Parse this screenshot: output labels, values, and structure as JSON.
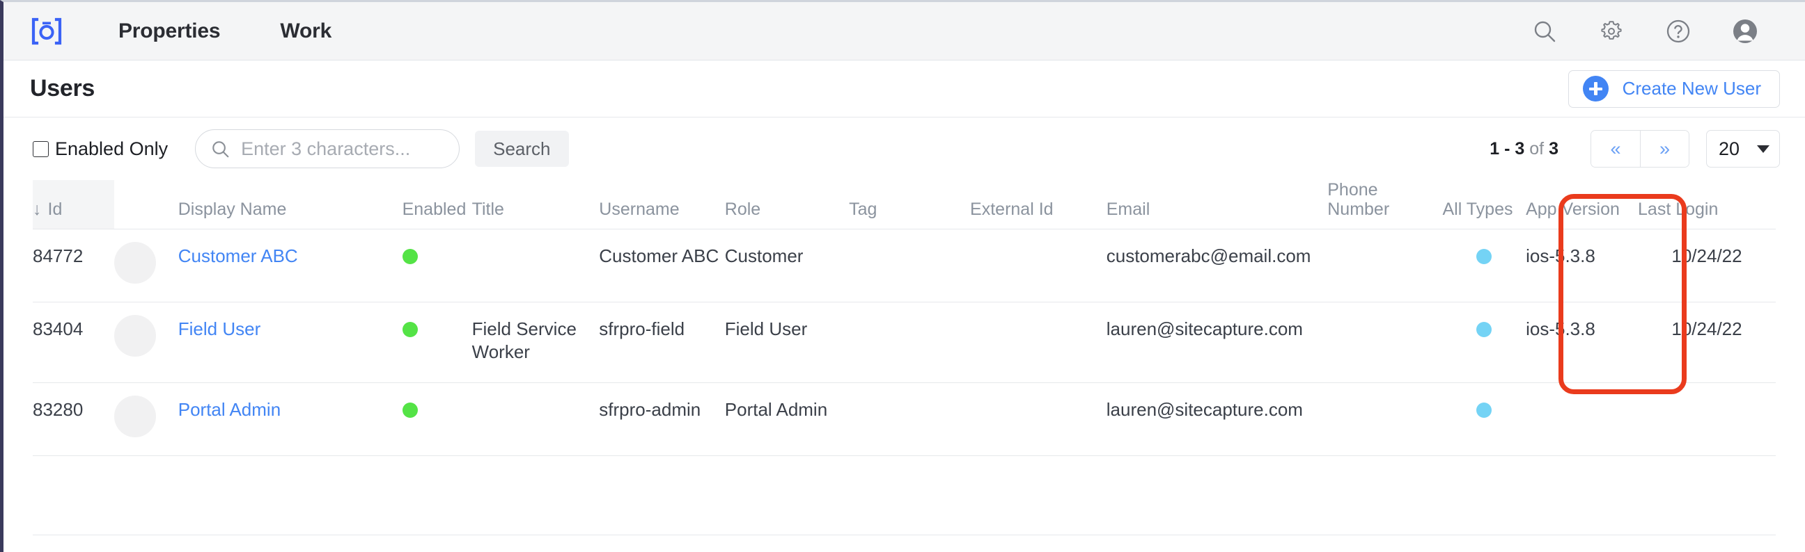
{
  "topbar": {
    "logo_icon": "camera-brackets-logo",
    "nav": [
      {
        "label": "Properties"
      },
      {
        "label": "Work"
      }
    ],
    "icons": [
      {
        "name": "search-icon"
      },
      {
        "name": "gear-icon"
      },
      {
        "name": "help-icon"
      },
      {
        "name": "avatar-icon"
      }
    ]
  },
  "page": {
    "title": "Users",
    "create_button": "Create New User"
  },
  "toolbar": {
    "enabled_only_label": "Enabled Only",
    "enabled_only_checked": false,
    "search_placeholder": "Enter 3 characters...",
    "search_value": "",
    "search_button": "Search",
    "range_start": "1",
    "range_end": "3",
    "range_of": "of",
    "total": "3",
    "range_text": "1 - 3",
    "prev_label": "«",
    "next_label": "»",
    "page_size": "20"
  },
  "table": {
    "sort_arrow": "↓",
    "columns": [
      {
        "key": "id",
        "label": "Id",
        "sorted": true
      },
      {
        "key": "avatar",
        "label": ""
      },
      {
        "key": "display_name",
        "label": "Display Name"
      },
      {
        "key": "enabled",
        "label": "Enabled"
      },
      {
        "key": "title",
        "label": "Title"
      },
      {
        "key": "username",
        "label": "Username"
      },
      {
        "key": "role",
        "label": "Role"
      },
      {
        "key": "tag",
        "label": "Tag"
      },
      {
        "key": "external_id",
        "label": "External Id"
      },
      {
        "key": "email",
        "label": "Email"
      },
      {
        "key": "phone_number",
        "label": "Phone Number"
      },
      {
        "key": "all_types",
        "label": "All Types"
      },
      {
        "key": "app_version",
        "label": "App Version"
      },
      {
        "key": "last_login",
        "label": "Last Login"
      }
    ],
    "rows": [
      {
        "id": "84772",
        "display_name": "Customer ABC",
        "enabled": true,
        "title": "",
        "username": "Customer ABC",
        "role": "Customer",
        "tag": "",
        "external_id": "",
        "email": "customerabc@email.com",
        "phone_number": "",
        "all_types": true,
        "app_version": "ios-5.3.8",
        "last_login": "10/24/22"
      },
      {
        "id": "83404",
        "display_name": "Field User",
        "enabled": true,
        "title": "Field Service Worker",
        "username": "sfrpro-field",
        "role": "Field User",
        "tag": "",
        "external_id": "",
        "email": "lauren@sitecapture.com",
        "phone_number": "",
        "all_types": true,
        "app_version": "ios-5.3.8",
        "last_login": "10/24/22"
      },
      {
        "id": "83280",
        "display_name": "Portal Admin",
        "enabled": true,
        "title": "",
        "username": "sfrpro-admin",
        "role": "Portal Admin",
        "tag": "",
        "external_id": "",
        "email": "lauren@sitecapture.com",
        "phone_number": "",
        "all_types": true,
        "app_version": "",
        "last_login": ""
      }
    ]
  },
  "annotation": {
    "shape": "rounded-rectangle",
    "color": "#ea3b1d",
    "target_column": "Last Login"
  },
  "colors": {
    "accent_blue": "#4285f4",
    "enabled_green": "#54e346",
    "type_blue": "#74d3f5",
    "annotation_red": "#ea3b1d"
  }
}
